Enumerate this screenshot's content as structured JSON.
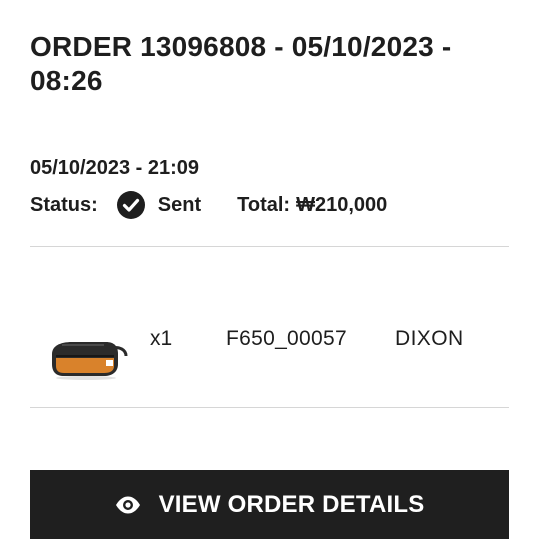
{
  "order": {
    "title": "ORDER 13096808 - 05/10/2023 - 08:26",
    "date": "05/10/2023 - 21:09",
    "status_label": "Status:",
    "status_icon": "check-circle-icon",
    "status_value": "Sent",
    "total_label": "Total:",
    "total_value": "₩210,000"
  },
  "items": [
    {
      "image_icon": "shoulder-bag-product-image",
      "quantity": "x1",
      "sku": "F650_00057",
      "name": "DIXON"
    }
  ],
  "actions": {
    "view_details_icon": "eye-icon",
    "view_details_label": "VIEW ORDER DETAILS"
  },
  "colors": {
    "text": "#1e1e1e",
    "button_background": "#1f1f1f",
    "button_text": "#ffffff",
    "divider": "#d6d6d6",
    "bag_accent": "#d9822b"
  }
}
